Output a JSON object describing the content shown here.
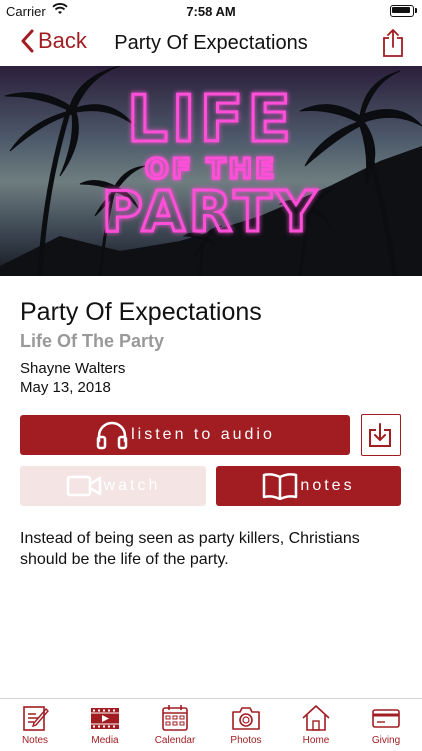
{
  "status_bar": {
    "carrier": "Carrier",
    "time": "7:58 AM"
  },
  "nav": {
    "back_label": "Back",
    "title": "Party Of Expectations"
  },
  "hero": {
    "line1": "LIFE",
    "line2": "OF THE",
    "line3": "PARTY"
  },
  "sermon": {
    "title": "Party Of Expectations",
    "series": "Life Of The Party",
    "speaker": "Shayne Walters",
    "date": "May 13, 2018",
    "description": "Instead of being seen as party killers, Christians should be the life of the party."
  },
  "actions": {
    "listen_label": "listen to audio",
    "watch_label": "watch",
    "notes_label": "notes"
  },
  "tabs": [
    {
      "label": "Notes",
      "icon": "notes-icon"
    },
    {
      "label": "Media",
      "icon": "film-icon"
    },
    {
      "label": "Calendar",
      "icon": "calendar-icon"
    },
    {
      "label": "Photos",
      "icon": "camera-icon"
    },
    {
      "label": "Home",
      "icon": "home-icon"
    },
    {
      "label": "Giving",
      "icon": "card-icon"
    }
  ],
  "colors": {
    "accent": "#a11d22",
    "watch_disabled": "#f4e4e4",
    "subtitle": "#999999"
  }
}
